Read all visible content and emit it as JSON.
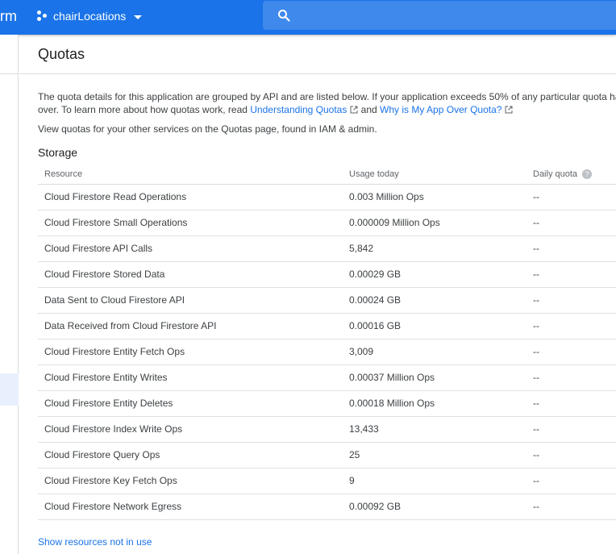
{
  "topbar": {
    "brand": "rm",
    "project": "chairLocations",
    "search_placeholder": "",
    "icons": [
      "project-icon",
      "chevron-down-icon",
      "search-icon"
    ]
  },
  "page": {
    "title": "Quotas"
  },
  "intro": {
    "line1": "The quota details for this application are grouped by API and are listed below. If your application exceeds 50% of any particular quota ha",
    "line2_prefix": "over. To learn more about how quotas work, read ",
    "link_understanding": "Understanding Quotas",
    "line2_mid": " and ",
    "link_why": "Why is My App Over Quota?",
    "line3_prefix": "View quotas for your other services on the ",
    "link_quotas_page": "Quotas page",
    "line3_suffix": ", found in IAM & admin."
  },
  "storage": {
    "title": "Storage",
    "headers": [
      "Resource",
      "Usage today",
      "Daily quota"
    ],
    "rows": [
      {
        "resource": "Cloud Firestore Read Operations",
        "usage": "0.003 Million Ops",
        "quota": "--"
      },
      {
        "resource": "Cloud Firestore Small Operations",
        "usage": "0.000009 Million Ops",
        "quota": "--"
      },
      {
        "resource": "Cloud Firestore API Calls",
        "usage": "5,842",
        "quota": "--"
      },
      {
        "resource": "Cloud Firestore Stored Data",
        "usage": "0.00029 GB",
        "quota": "--"
      },
      {
        "resource": "Data Sent to Cloud Firestore API",
        "usage": "0.00024 GB",
        "quota": "--"
      },
      {
        "resource": "Data Received from Cloud Firestore API",
        "usage": "0.00016 GB",
        "quota": "--"
      },
      {
        "resource": "Cloud Firestore Entity Fetch Ops",
        "usage": "3,009",
        "quota": "--"
      },
      {
        "resource": "Cloud Firestore Entity Writes",
        "usage": "0.00037 Million Ops",
        "quota": "--"
      },
      {
        "resource": "Cloud Firestore Entity Deletes",
        "usage": "0.00018 Million Ops",
        "quota": "--"
      },
      {
        "resource": "Cloud Firestore Index Write Ops",
        "usage": "13,433",
        "quota": "--"
      },
      {
        "resource": "Cloud Firestore Query Ops",
        "usage": "25",
        "quota": "--"
      },
      {
        "resource": "Cloud Firestore Key Fetch Ops",
        "usage": "9",
        "quota": "--"
      },
      {
        "resource": "Cloud Firestore Network Egress",
        "usage": "0.00092 GB",
        "quota": "--"
      }
    ],
    "help_glyph": "?"
  },
  "footer": {
    "show_resources": "Show resources not in use"
  },
  "colors": {
    "topbar": "#1a73e8",
    "link": "#1a73e8",
    "divider": "#dadce0"
  }
}
